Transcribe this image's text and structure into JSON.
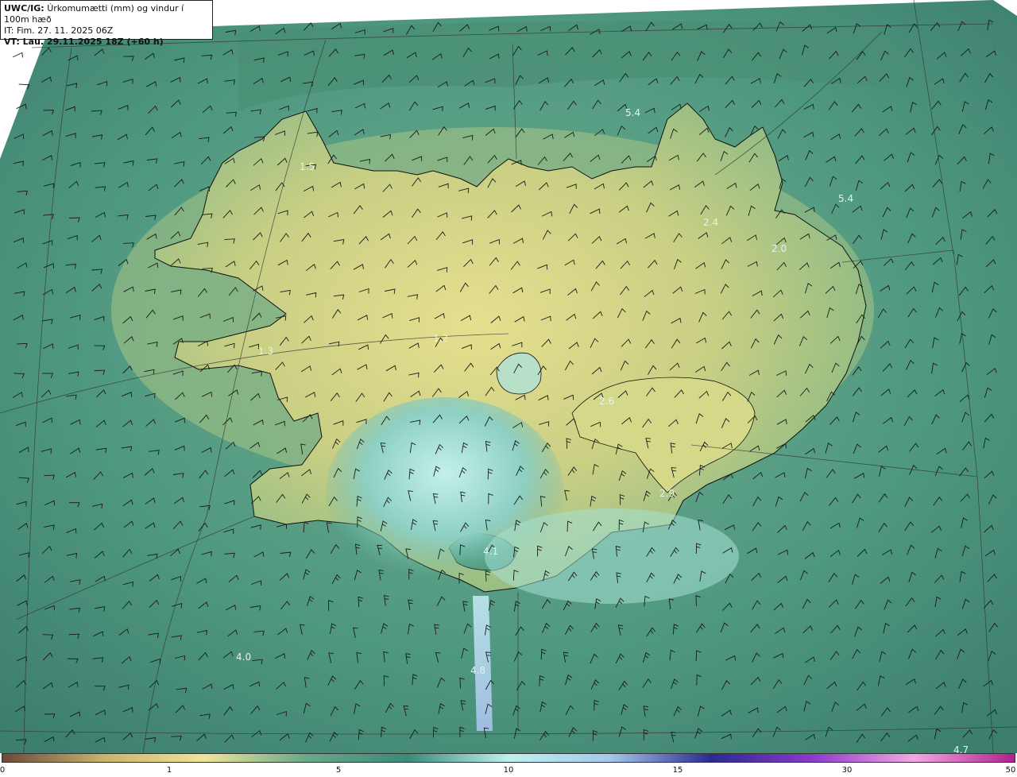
{
  "header": {
    "model": "UWC/IG:",
    "title": "Úrkomumætti (mm) og vindur í 100m hæð",
    "issue_time": "IT: Fim. 27. 11. 2025 06Z",
    "valid_time": "VT: Lau. 29.11.2025 18Z (+60 h)"
  },
  "colorbar": {
    "ticks": [
      {
        "label": "0",
        "value": 0
      },
      {
        "label": "1",
        "value": 1
      },
      {
        "label": "5",
        "value": 5
      },
      {
        "label": "10",
        "value": 10
      },
      {
        "label": "15",
        "value": 15
      },
      {
        "label": "30",
        "value": 30
      },
      {
        "label": "50",
        "value": 50
      }
    ],
    "colors": [
      "#6b4a3a",
      "#c9b26c",
      "#efe59a",
      "#6aa88a",
      "#3b8a78",
      "#bff0ee",
      "#a5c8ea",
      "#2a2a8f",
      "#8a3ac9",
      "#f2a8e2",
      "#b0208e"
    ]
  },
  "labels": [
    {
      "text": "5.4"
    },
    {
      "text": "5.4"
    },
    {
      "text": "2.4"
    },
    {
      "text": "2.0"
    },
    {
      "text": "2.6"
    },
    {
      "text": "2.9"
    },
    {
      "text": "4.1"
    },
    {
      "text": "4.0"
    },
    {
      "text": "4.7"
    },
    {
      "text": "1.5"
    },
    {
      "text": "1.3"
    },
    {
      "text": "1.2"
    },
    {
      "text": "4.8"
    }
  ],
  "legend_colors": {
    "land_high": "#e6df8e",
    "sea_mid": "#4f9a7e",
    "sea_light": "#b8ece6"
  }
}
